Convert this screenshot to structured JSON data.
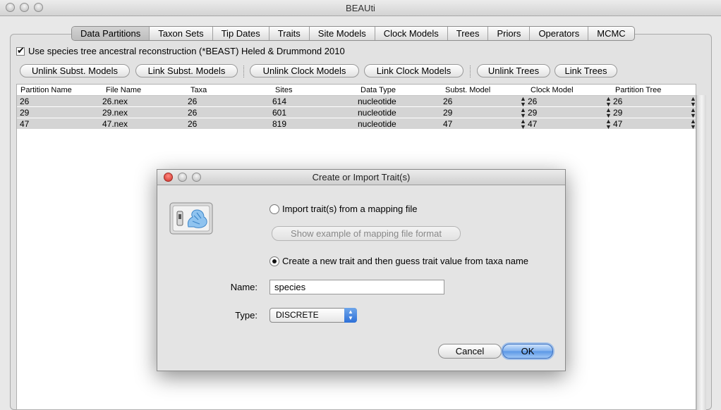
{
  "window": {
    "title": "BEAUti"
  },
  "tabs": [
    {
      "label": "Data Partitions",
      "selected": true
    },
    {
      "label": "Taxon Sets"
    },
    {
      "label": "Tip Dates"
    },
    {
      "label": "Traits"
    },
    {
      "label": "Site Models"
    },
    {
      "label": "Clock Models"
    },
    {
      "label": "Trees"
    },
    {
      "label": "Priors"
    },
    {
      "label": "Operators"
    },
    {
      "label": "MCMC"
    }
  ],
  "species_checkbox": {
    "label": "Use species tree ancestral reconstruction (*BEAST) Heled & Drummond 2010",
    "checked": true
  },
  "buttons": {
    "unlink_subst": "Unlink Subst. Models",
    "link_subst": "Link Subst. Models",
    "unlink_clock": "Unlink Clock Models",
    "link_clock": "Link Clock Models",
    "unlink_trees": "Unlink Trees",
    "link_trees": "Link Trees"
  },
  "table": {
    "headers": [
      "Partition Name",
      "File Name",
      "Taxa",
      "Sites",
      "Data Type",
      "Subst. Model",
      "Clock Model",
      "Partition Tree"
    ],
    "rows": [
      [
        "26",
        "26.nex",
        "26",
        "614",
        "nucleotide",
        "26",
        "26",
        "26"
      ],
      [
        "29",
        "29.nex",
        "26",
        "601",
        "nucleotide",
        "29",
        "29",
        "29"
      ],
      [
        "47",
        "47.nex",
        "26",
        "819",
        "nucleotide",
        "47",
        "47",
        "47"
      ]
    ]
  },
  "dialog": {
    "title": "Create or Import Trait(s)",
    "import_option": "Import trait(s) from a mapping file",
    "show_example": "Show example of mapping file format",
    "create_option": "Create a new trait and then guess trait value from taxa name",
    "selected_option": "create",
    "name_label": "Name:",
    "name_value": "species",
    "type_label": "Type:",
    "type_value": "DISCRETE",
    "cancel": "Cancel",
    "ok": "OK"
  },
  "colors": {
    "close_red": "#e0443e",
    "ok_blue": "#5a97e6",
    "row_gray": "#d4d4d4"
  }
}
